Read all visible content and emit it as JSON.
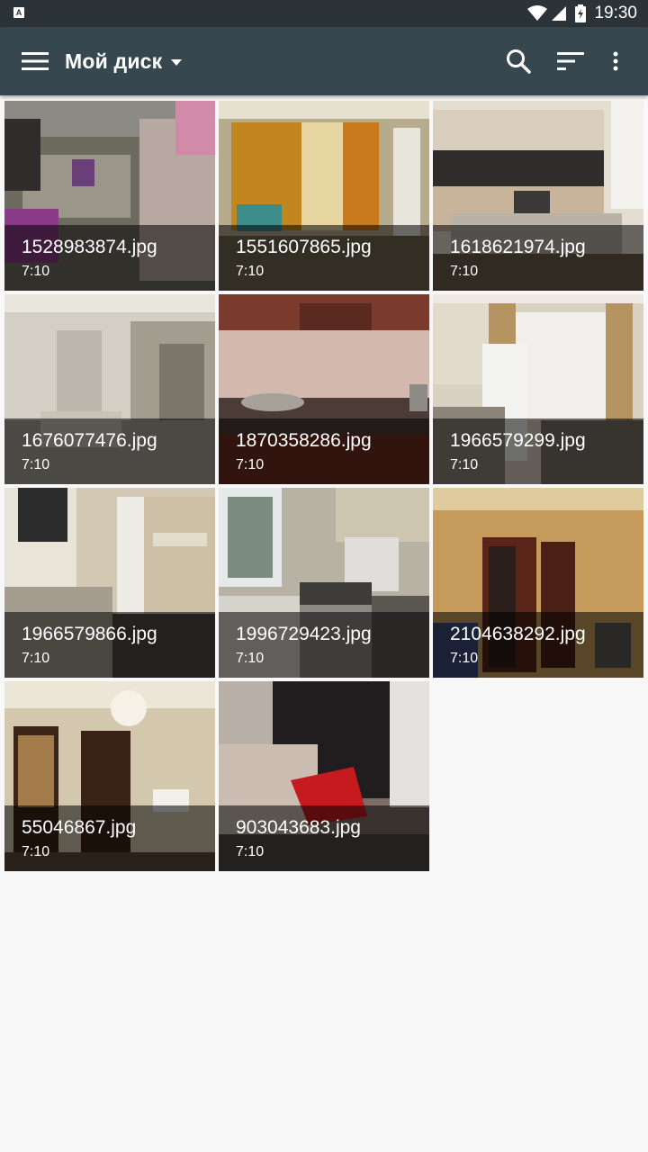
{
  "status_bar": {
    "time": "19:30",
    "notification_badge": "A",
    "icons": [
      "wifi-icon",
      "cell-signal-icon",
      "battery-icon"
    ]
  },
  "app_bar": {
    "title": "Мой диск",
    "icons": [
      "menu-icon",
      "dropdown-caret-icon",
      "search-icon",
      "sort-icon",
      "more-vert-icon"
    ],
    "background": "#37474f"
  },
  "files": [
    {
      "name": "1528983874.jpg",
      "time": "7:10"
    },
    {
      "name": "1551607865.jpg",
      "time": "7:10"
    },
    {
      "name": "1618621974.jpg",
      "time": "7:10"
    },
    {
      "name": "1676077476.jpg",
      "time": "7:10"
    },
    {
      "name": "1870358286.jpg",
      "time": "7:10"
    },
    {
      "name": "1966579299.jpg",
      "time": "7:10"
    },
    {
      "name": "1966579866.jpg",
      "time": "7:10"
    },
    {
      "name": "1996729423.jpg",
      "time": "7:10"
    },
    {
      "name": "2104638292.jpg",
      "time": "7:10"
    },
    {
      "name": "55046867.jpg",
      "time": "7:10"
    },
    {
      "name": "903043683.jpg",
      "time": "7:10"
    }
  ]
}
